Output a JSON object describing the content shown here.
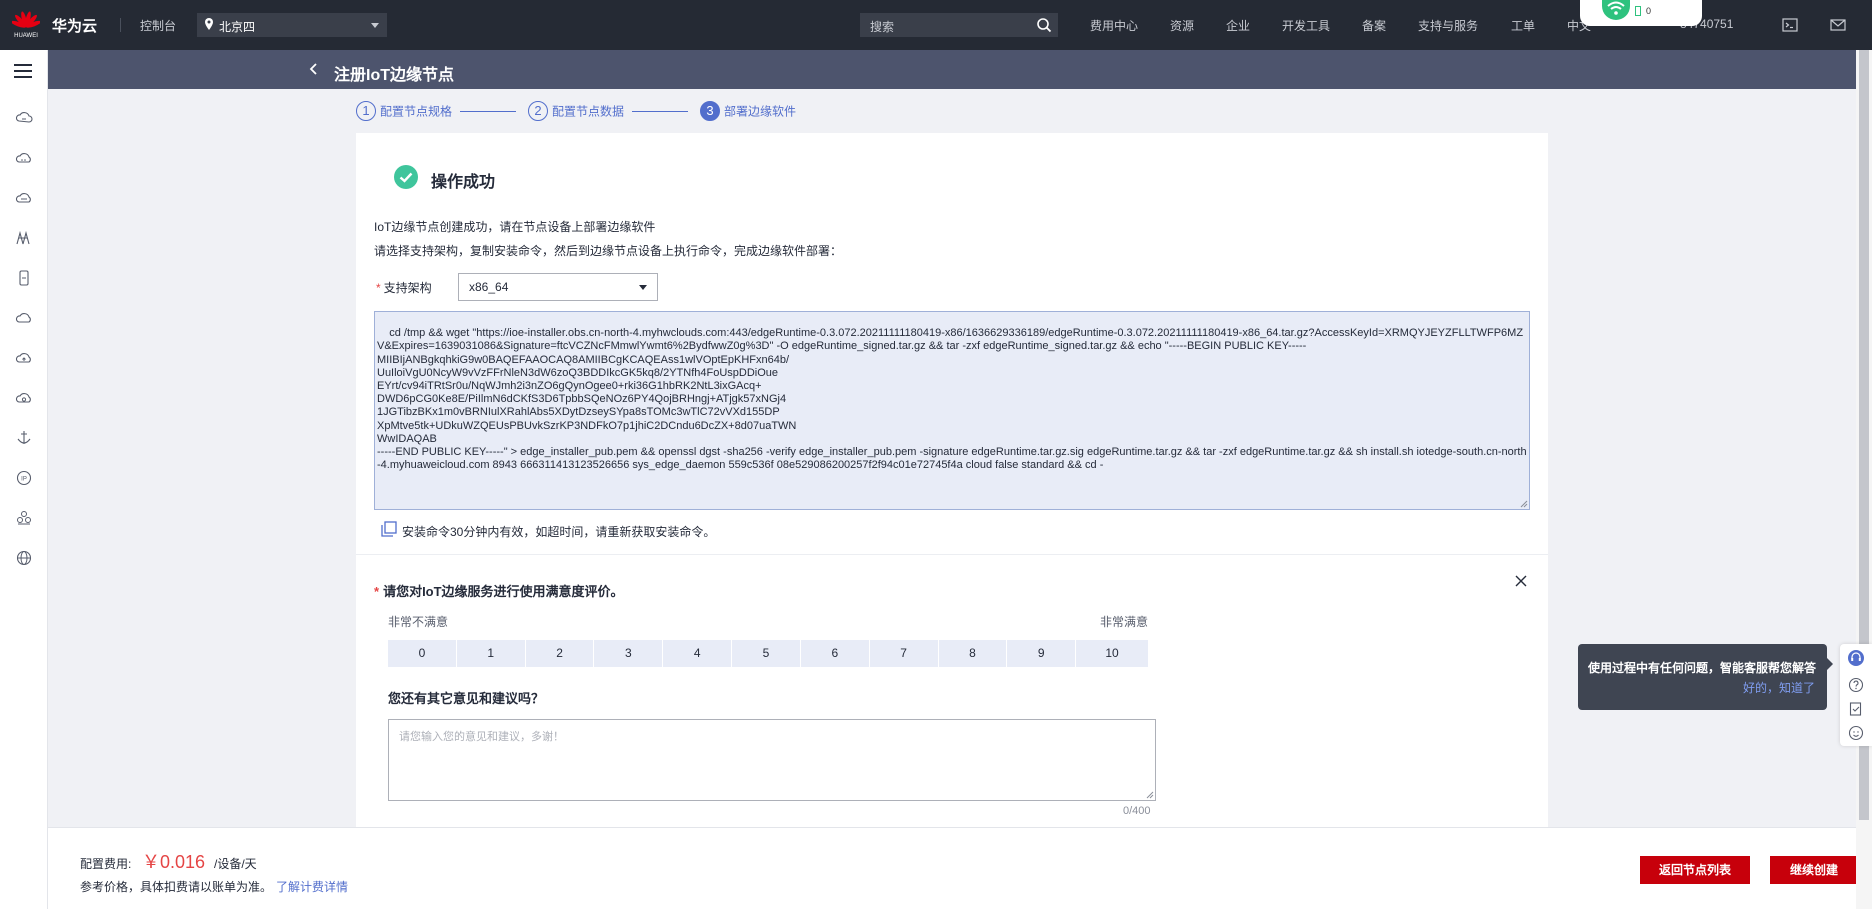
{
  "topbar": {
    "logo_caption": "HUAWEI",
    "brand": "华为云",
    "console": "控制台",
    "region": "北京四",
    "search_placeholder": "搜索",
    "nav": [
      "费用中心",
      "资源",
      "企业",
      "开发工具",
      "备案",
      "支持与服务",
      "工单",
      "中文"
    ],
    "account_suffix": "84740751",
    "status_count": "0"
  },
  "sidebar": {
    "icons": [
      "cloud-server-icon",
      "cloud-service-icon",
      "database-icon",
      "network-icon",
      "mobile-icon",
      "cloud-icon",
      "cloud-upload-icon",
      "cloud-refresh-icon",
      "anchor-icon",
      "ip-icon",
      "cluster-icon",
      "globe-icon"
    ]
  },
  "page": {
    "title": "注册IoT边缘节点"
  },
  "steps": [
    {
      "num": "1",
      "label": "配置节点规格"
    },
    {
      "num": "2",
      "label": "配置节点数据"
    },
    {
      "num": "3",
      "label": "部署边缘软件"
    }
  ],
  "result": {
    "title": "操作成功",
    "info1": "IoT边缘节点创建成功，请在节点设备上部署边缘软件",
    "info2": "请选择支持架构，复制安装命令，然后到边缘节点设备上执行命令，完成边缘软件部署：",
    "arch_label": "支持架构",
    "arch_value": "x86_64",
    "command": "cd /tmp && wget \"https://ioe-installer.obs.cn-north-4.myhwclouds.com:443/edgeRuntime-0.3.072.20211111180419-x86/1636629336189/edgeRuntime-0.3.072.20211111180419-x86_64.tar.gz?AccessKeyId=XRMQYJEYZFLLTWFP6MZV&Expires=1639031086&Signature=ftcVCZNcFMmwlYwmt6%2BydfwwZ0g%3D\" -O edgeRuntime_signed.tar.gz && tar -zxf edgeRuntime_signed.tar.gz && echo \"-----BEGIN PUBLIC KEY-----\nMIIBIjANBgkqhkiG9w0BAQEFAAOCAQ8AMIIBCgKCAQEAss1wlVOptEpKHFxn64b/\nUuIloiVgU0NcyW9vVzFFrNleN3dW6zoQ3BDDIkcGK5kq8/2YTNfh4FoUspDDiOue\nEYrt/cv94iTRtSr0u/NqWJmh2i3nZO6gQynOgee0+rki36G1hbRK2NtL3ixGAcq+\nDWD6pCG0Ke8E/PiIlmN6dCKfS3D6TpbbSQeNOz6PY4QojBRHngj+ATjgk57xNGj4\n1JGTibzBKx1m0vBRNIulXRahlAbs5XDytDzseySYpa8sTOMc3wTlC72vVXd155DP\nXpMtve5tk+UDkuWZQEUsPBUvkSzrKP3NDFkO7p1jhiC2DCndu6DcZX+8d07uaTWN\nWwIDAQAB\n-----END PUBLIC KEY-----\" > edge_installer_pub.pem && openssl dgst -sha256 -verify edge_installer_pub.pem -signature edgeRuntime.tar.gz.sig edgeRuntime.tar.gz && tar -zxf edgeRuntime.tar.gz && sh install.sh iotedge-south.cn-north-4.myhuaweicloud.com 8943 666311413123526656 sys_edge_daemon 559c536f 08e529086200257f2f94c01e72745f4a cloud false standard && cd -",
    "copy_note": "安装命令30分钟内有效，如超时间，请重新获取安装命令。"
  },
  "survey": {
    "title": "请您对IoT边缘服务进行使用满意度评价。",
    "low_label": "非常不满意",
    "high_label": "非常满意",
    "scores": [
      "0",
      "1",
      "2",
      "3",
      "4",
      "5",
      "6",
      "7",
      "8",
      "9",
      "10"
    ],
    "question2": "您还有其它意见和建议吗？",
    "feedback_placeholder": "请您输入您的意见和建议，多谢！",
    "counter": "0/400"
  },
  "footer": {
    "fee_label": "配置费用:",
    "fee_price": "￥0.016",
    "fee_unit": "/设备/天",
    "ref_note": "参考价格，具体扣费请以账单为准。",
    "ref_link": "了解计费详情",
    "btn_back": "返回节点列表",
    "btn_continue": "继续创建"
  },
  "helper": {
    "message": "使用过程中有任何问题，智能客服帮您解答",
    "ok": "好的，知道了"
  },
  "colors": {
    "accent": "#526ecc",
    "danger": "#c7000b",
    "success": "#3fc59c",
    "topbar": "#252a34",
    "titlebar": "#4d546d"
  }
}
